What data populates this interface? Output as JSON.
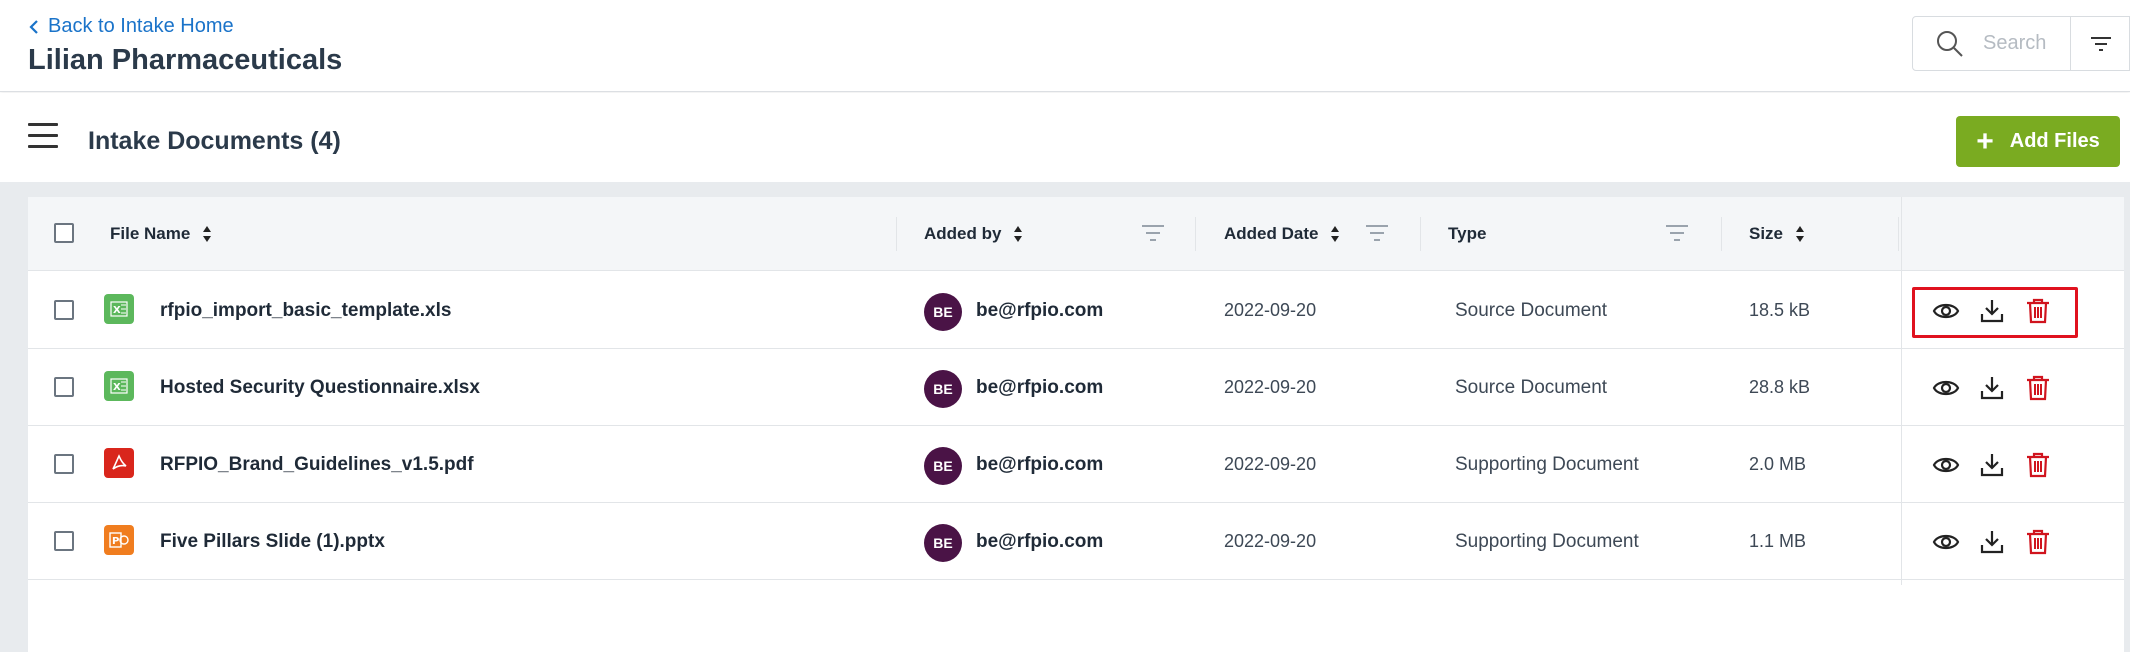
{
  "header": {
    "back_label": "Back to Intake Home",
    "title": "Lilian Pharmaceuticals",
    "search_placeholder": "Search"
  },
  "subbar": {
    "title": "Intake Documents (4)",
    "add_files_label": "Add Files"
  },
  "table": {
    "columns": {
      "file_name": "File Name",
      "added_by": "Added by",
      "added_date": "Added Date",
      "type": "Type",
      "size": "Size"
    },
    "rows": [
      {
        "file_name": "rfpio_import_basic_template.xls",
        "file_kind": "excel",
        "avatar": "BE",
        "added_by": "be@rfpio.com",
        "added_date": "2022-09-20",
        "type": "Source Document",
        "size": "18.5 kB"
      },
      {
        "file_name": "Hosted Security Questionnaire.xlsx",
        "file_kind": "excel",
        "avatar": "BE",
        "added_by": "be@rfpio.com",
        "added_date": "2022-09-20",
        "type": "Source Document",
        "size": "28.8 kB"
      },
      {
        "file_name": "RFPIO_Brand_Guidelines_v1.5.pdf",
        "file_kind": "pdf",
        "avatar": "BE",
        "added_by": "be@rfpio.com",
        "added_date": "2022-09-20",
        "type": "Supporting Document",
        "size": "2.0 MB"
      },
      {
        "file_name": "Five Pillars Slide (1).pptx",
        "file_kind": "powerpoint",
        "avatar": "BE",
        "added_by": "be@rfpio.com",
        "added_date": "2022-09-20",
        "type": "Supporting Document",
        "size": "1.1 MB"
      }
    ]
  },
  "colors": {
    "accent_link": "#1a73c9",
    "add_button": "#7aab21",
    "avatar_bg": "#4a1346",
    "delete_icon": "#d0141e",
    "highlight": "#e0121f",
    "excel": "#5cb85c",
    "pdf": "#d9261c",
    "powerpoint": "#f07d1f"
  },
  "icons": {
    "back": "chevron-left-icon",
    "search": "search-icon",
    "filter": "filter-lines-icon",
    "menu": "hamburger-menu-icon",
    "add": "plus-icon",
    "sort": "sort-arrows-icon",
    "view": "eye-icon",
    "download": "download-icon",
    "delete": "trash-icon"
  }
}
